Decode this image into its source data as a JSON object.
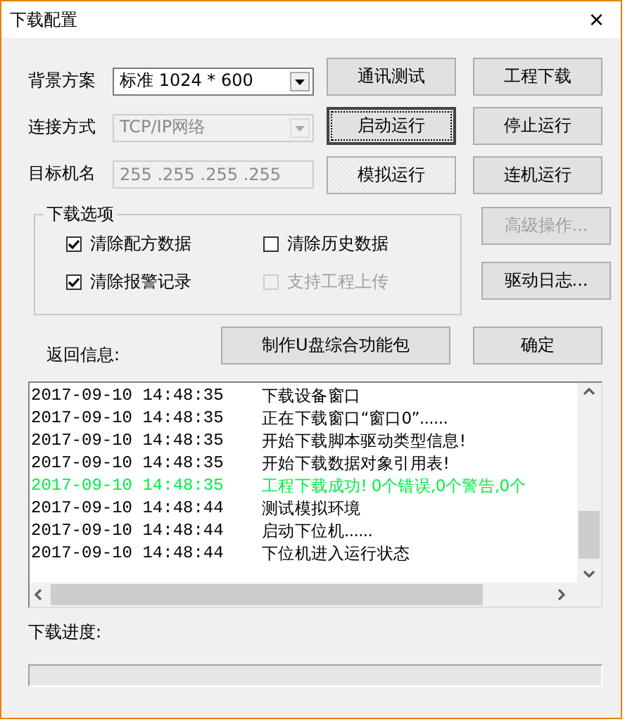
{
  "window": {
    "title": "下载配置",
    "close": "×"
  },
  "fields": [
    {
      "label": "背景方案",
      "kind": "select",
      "value": "标准 1024 * 600",
      "disabled": false
    },
    {
      "label": "连接方式",
      "kind": "select",
      "value": "TCP/IP网络",
      "disabled": true
    },
    {
      "label": "目标机名",
      "kind": "text",
      "value": "255 .255 .255 .255",
      "disabled": true
    }
  ],
  "buttons": [
    {
      "label": "通讯测试",
      "disabled": false,
      "focused": false,
      "pressed": false
    },
    {
      "label": "工程下载",
      "disabled": false,
      "focused": false,
      "pressed": false
    },
    {
      "label": "启动运行",
      "disabled": false,
      "focused": true,
      "pressed": false
    },
    {
      "label": "停止运行",
      "disabled": false,
      "focused": false,
      "pressed": false
    },
    {
      "label": "模拟运行",
      "disabled": false,
      "focused": false,
      "pressed": true
    },
    {
      "label": "连机运行",
      "disabled": false,
      "focused": false,
      "pressed": false
    }
  ],
  "download_options": {
    "title": "下载选项",
    "options": [
      {
        "label": "清除配方数据",
        "checked": true,
        "disabled": false
      },
      {
        "label": "清除历史数据",
        "checked": false,
        "disabled": false
      },
      {
        "label": "清除报警记录",
        "checked": true,
        "disabled": false
      },
      {
        "label": "支持工程上传",
        "checked": false,
        "disabled": true
      }
    ]
  },
  "side_buttons": [
    {
      "label": "高级操作...",
      "disabled": true
    },
    {
      "label": "驱动日志...",
      "disabled": false
    }
  ],
  "usb_button": "制作U盘综合功能包",
  "ok_button": "确定",
  "log": {
    "label": "返回信息:",
    "rows": [
      {
        "time": "2017-09-10 14:48:35",
        "message": "下载设备窗口",
        "color": "#000000"
      },
      {
        "time": "2017-09-10 14:48:35",
        "message": "正在下载窗口“窗口0”......",
        "color": "#000000"
      },
      {
        "time": "2017-09-10 14:48:35",
        "message": "开始下载脚本驱动类型信息!",
        "color": "#000000"
      },
      {
        "time": "2017-09-10 14:48:35",
        "message": "开始下载数据对象引用表!",
        "color": "#000000"
      },
      {
        "time": "2017-09-10 14:48:35",
        "message": "工程下载成功! 0个错误,0个警告,0个",
        "color": "#00ee44"
      },
      {
        "time": "2017-09-10 14:48:44",
        "message": "测试模拟环境",
        "color": "#000000"
      },
      {
        "time": "2017-09-10 14:48:44",
        "message": "启动下位机......",
        "color": "#000000"
      },
      {
        "time": "2017-09-10 14:48:44",
        "message": "下位机进入运行状态",
        "color": "#000000"
      }
    ]
  },
  "progress": {
    "label": "下载进度:",
    "level": 0
  }
}
